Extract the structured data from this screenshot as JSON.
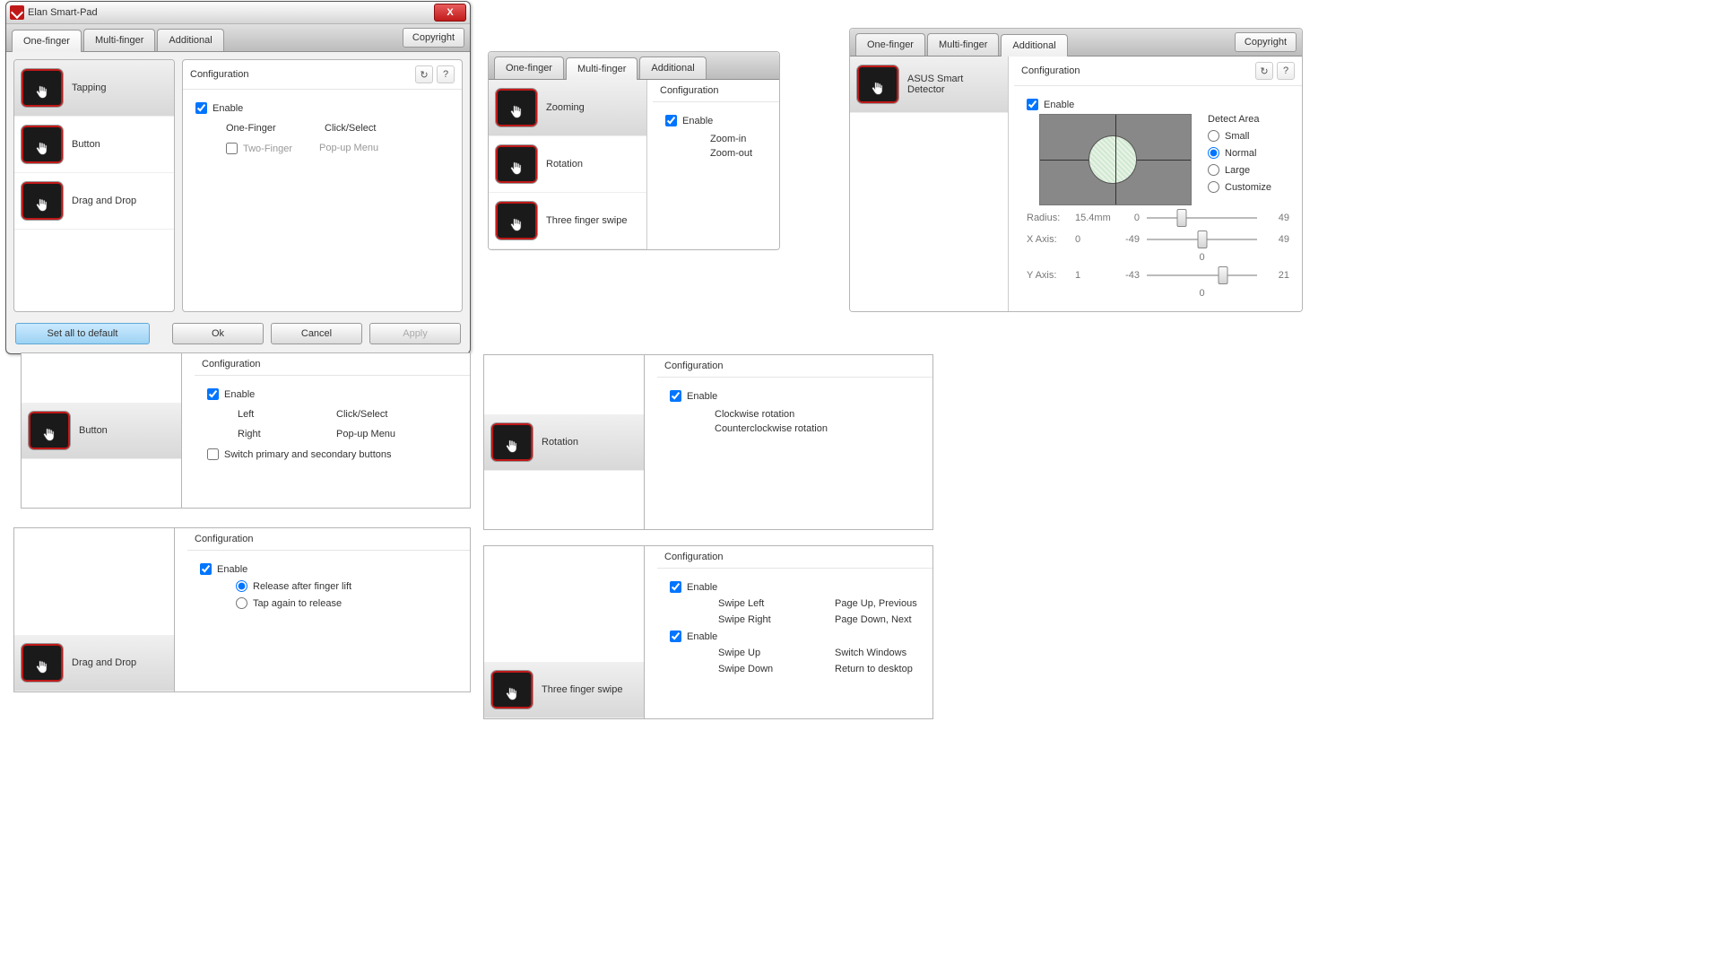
{
  "window": {
    "title": "Elan Smart-Pad",
    "close": "X",
    "copyright": "Copyright",
    "tabs": [
      "One-finger",
      "Multi-finger",
      "Additional"
    ],
    "buttons": {
      "default": "Set all to default",
      "ok": "Ok",
      "cancel": "Cancel",
      "apply": "Apply"
    }
  },
  "cfg_label": "Configuration",
  "enable_label": "Enable",
  "refresh": "↻",
  "help": "?",
  "panel1": {
    "items": [
      "Tapping",
      "Button",
      "Drag and Drop"
    ],
    "onefinger": "One-Finger",
    "click": "Click/Select",
    "twofinger": "Two-Finger",
    "popup": "Pop-up Menu"
  },
  "panel2": {
    "tabs": [
      "One-finger",
      "Multi-finger",
      "Additional"
    ],
    "items": [
      "Zooming",
      "Rotation",
      "Three finger swipe"
    ],
    "zoomin": "Zoom-in",
    "zoomout": "Zoom-out"
  },
  "panel3": {
    "tabs": [
      "One-finger",
      "Multi-finger",
      "Additional"
    ],
    "item": "ASUS Smart Detector",
    "detect_label": "Detect Area",
    "options": [
      "Small",
      "Normal",
      "Large",
      "Customize"
    ],
    "radius_label": "Radius:",
    "radius_val": "15.4mm",
    "xaxis_label": "X Axis:",
    "xaxis_val": "0",
    "yaxis_label": "Y Axis:",
    "yaxis_val": "1",
    "s1": {
      "min": "0",
      "max": "49"
    },
    "s2": {
      "min": "-49",
      "max": "49",
      "below": "0"
    },
    "s3": {
      "min": "-43",
      "max": "21",
      "below": "0"
    }
  },
  "panel4": {
    "item": "Button",
    "left": "Left",
    "click": "Click/Select",
    "right": "Right",
    "popup": "Pop-up Menu",
    "switch": "Switch primary and secondary buttons"
  },
  "panel5": {
    "item": "Rotation",
    "cw": "Clockwise rotation",
    "ccw": "Counterclockwise rotation"
  },
  "panel6": {
    "item": "Drag and Drop",
    "opt1": "Release after finger lift",
    "opt2": "Tap again to release"
  },
  "panel7": {
    "item": "Three finger swipe",
    "sl": "Swipe Left",
    "slv": "Page Up, Previous",
    "sr": "Swipe Right",
    "srv": "Page Down, Next",
    "su": "Swipe Up",
    "suv": "Switch Windows",
    "sd": "Swipe Down",
    "sdv": "Return to desktop"
  }
}
